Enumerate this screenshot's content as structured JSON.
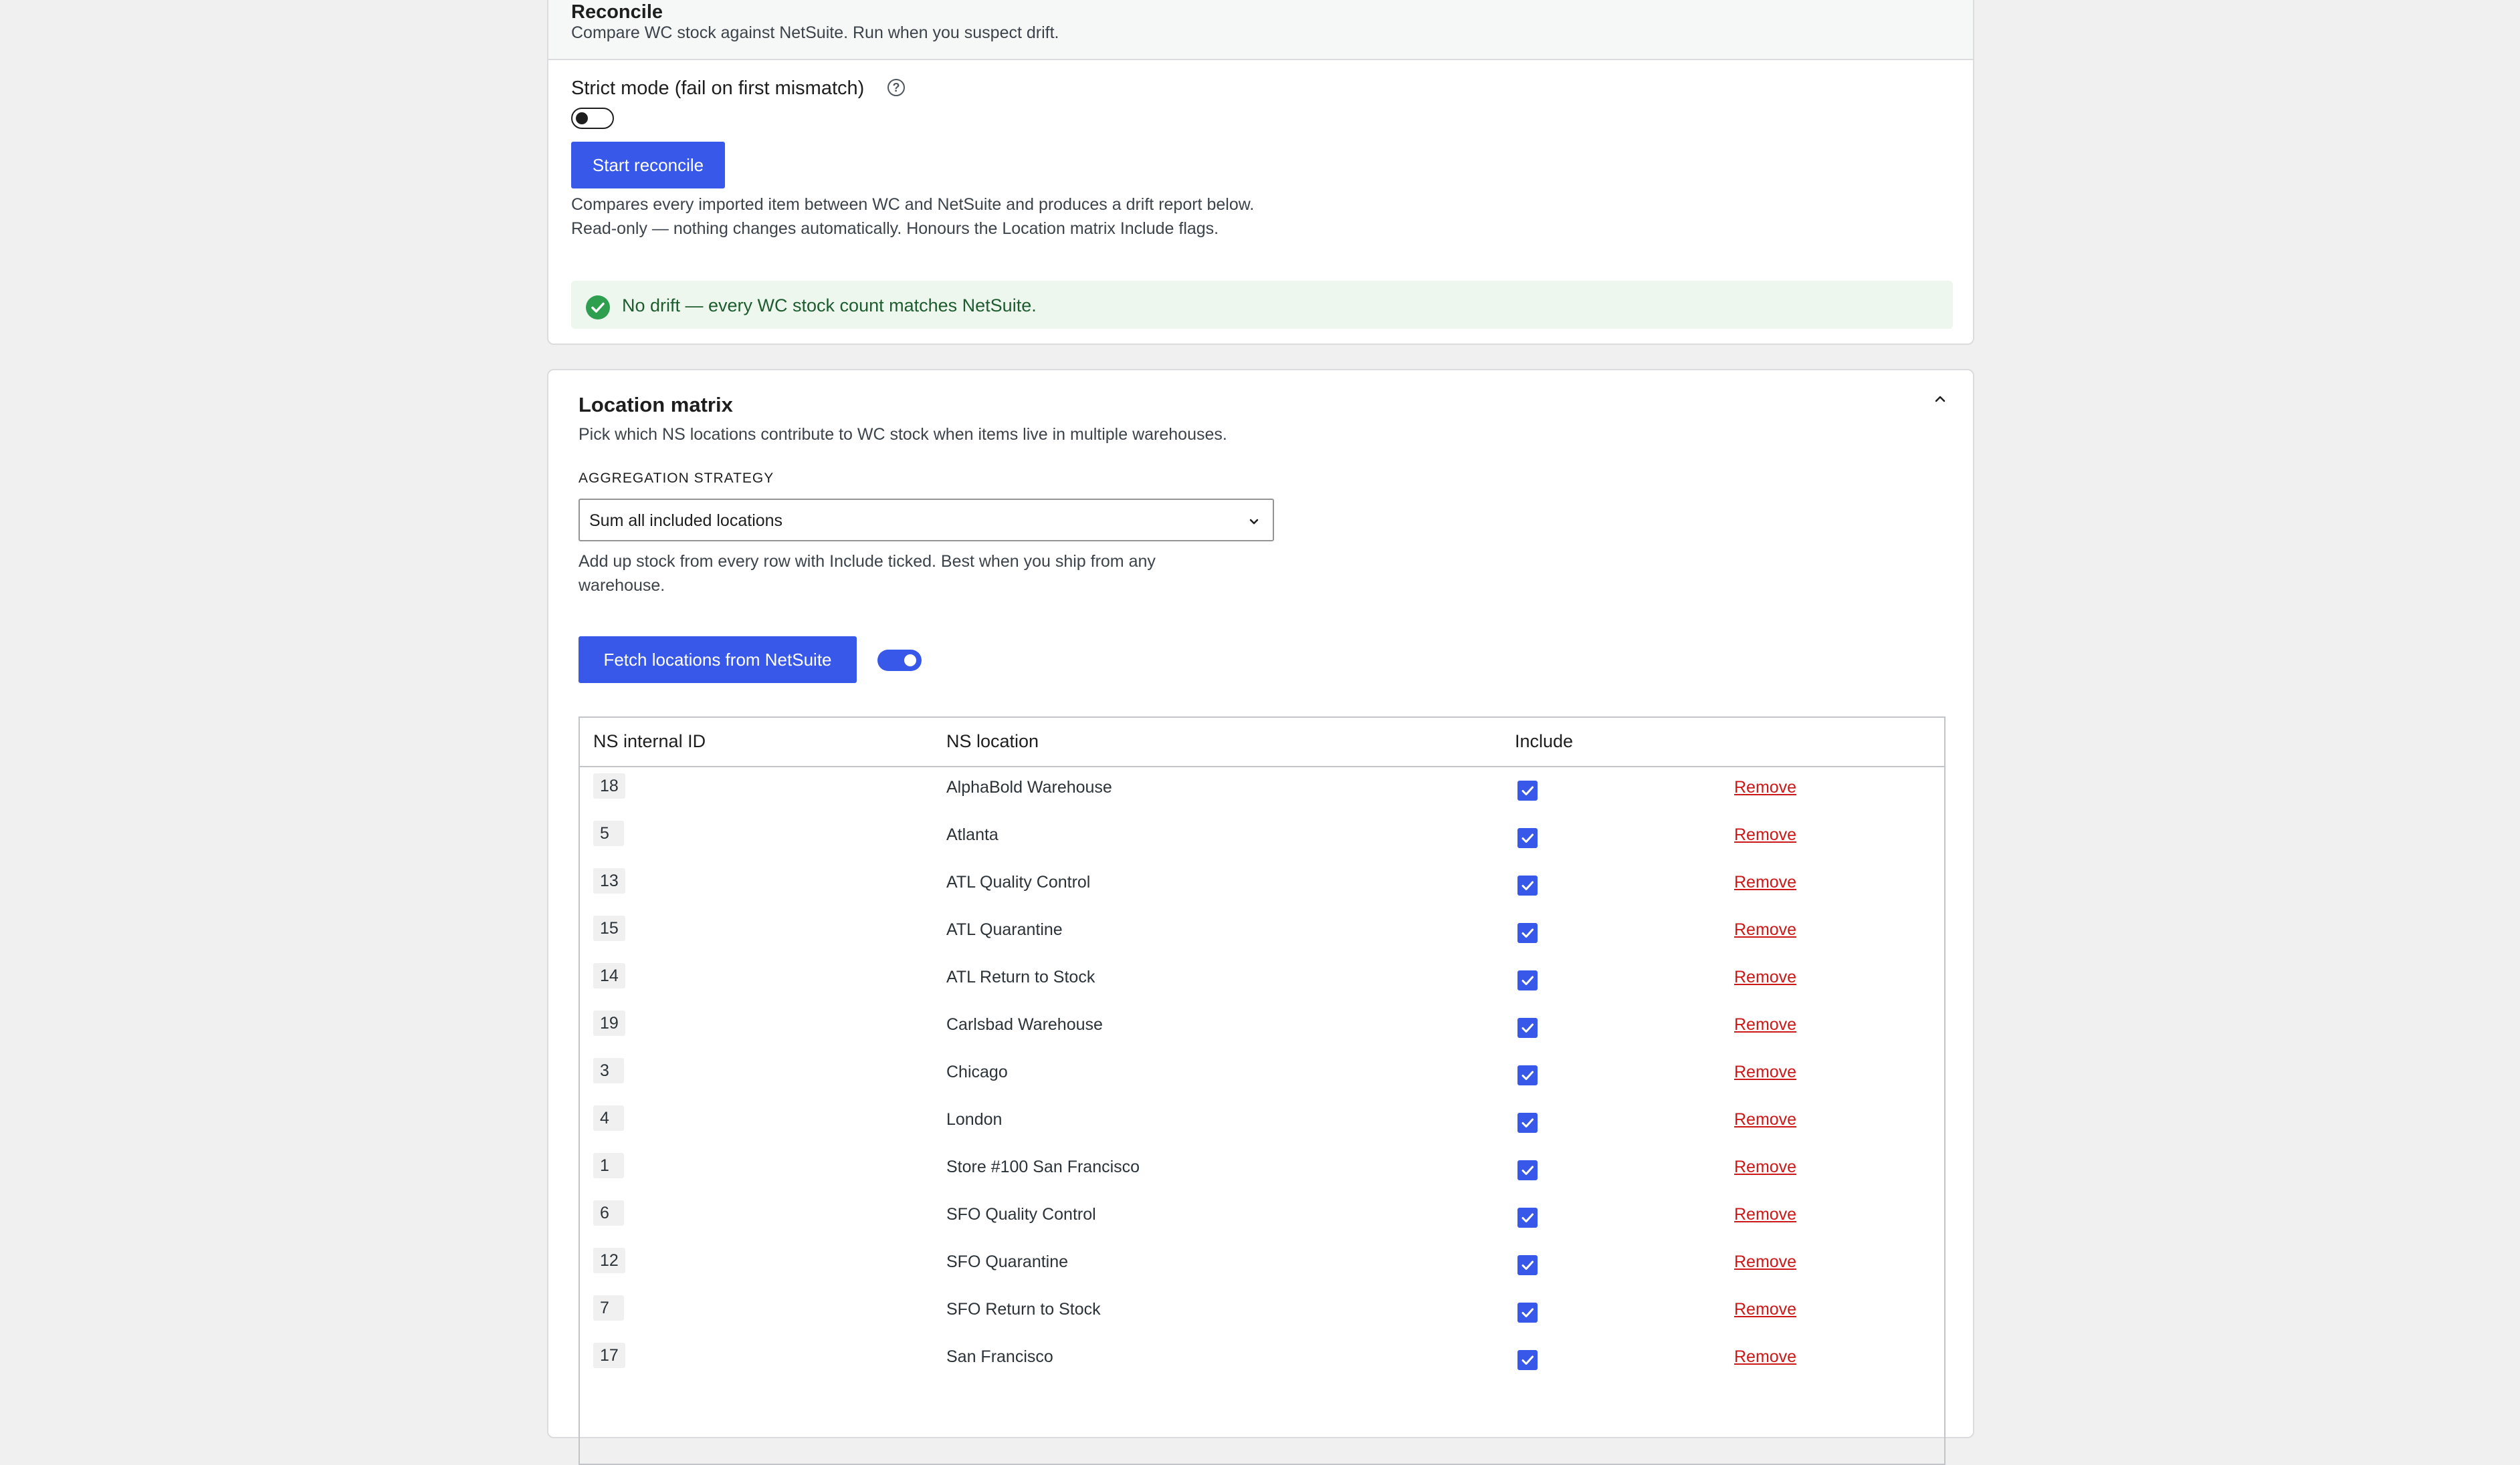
{
  "reconcile": {
    "title": "Reconcile",
    "subtitle": "Compare WC stock against NetSuite. Run when you suspect drift.",
    "strict_mode_label": "Strict mode (fail on first mismatch)",
    "strict_mode_on": false,
    "help_icon": "?",
    "start_button": "Start reconcile",
    "description_line1": "Compares every imported item between WC and NetSuite and produces a drift report below.",
    "description_line2": "Read-only — nothing changes automatically. Honours the Location matrix Include flags.",
    "notice": "No drift — every WC stock count matches NetSuite.",
    "notice_color": "#edf7ee"
  },
  "location_matrix": {
    "title": "Location matrix",
    "subtitle": "Pick which NS locations contribute to WC stock when items live in multiple warehouses.",
    "aggregation_label": "AGGREGATION STRATEGY",
    "aggregation_value": "Sum all included locations",
    "aggregation_help_line1": "Add up stock from every row with Include ticked. Best when you ship from any",
    "aggregation_help_line2": "warehouse.",
    "fetch_button": "Fetch locations from NetSuite",
    "fetch_toggle_on": true,
    "table": {
      "headers": [
        "NS internal ID",
        "NS location",
        "Include"
      ],
      "remove_label": "Remove",
      "rows": [
        {
          "id": "18",
          "name": "AlphaBold Warehouse",
          "include": true
        },
        {
          "id": "5",
          "name": "Atlanta",
          "include": true
        },
        {
          "id": "13",
          "name": "ATL Quality Control",
          "include": true
        },
        {
          "id": "15",
          "name": "ATL Quarantine",
          "include": true
        },
        {
          "id": "14",
          "name": "ATL Return to Stock",
          "include": true
        },
        {
          "id": "19",
          "name": "Carlsbad Warehouse",
          "include": true
        },
        {
          "id": "3",
          "name": "Chicago",
          "include": true
        },
        {
          "id": "4",
          "name": "London",
          "include": true
        },
        {
          "id": "1",
          "name": "Store #100 San Francisco",
          "include": true
        },
        {
          "id": "6",
          "name": "SFO Quality Control",
          "include": true
        },
        {
          "id": "12",
          "name": "SFO Quarantine",
          "include": true
        },
        {
          "id": "7",
          "name": "SFO Return to Stock",
          "include": true
        },
        {
          "id": "17",
          "name": "San Francisco",
          "include": true
        }
      ]
    }
  },
  "colors": {
    "accent": "#3858e9",
    "danger": "#cc1818",
    "success": "#2e9f4f"
  }
}
